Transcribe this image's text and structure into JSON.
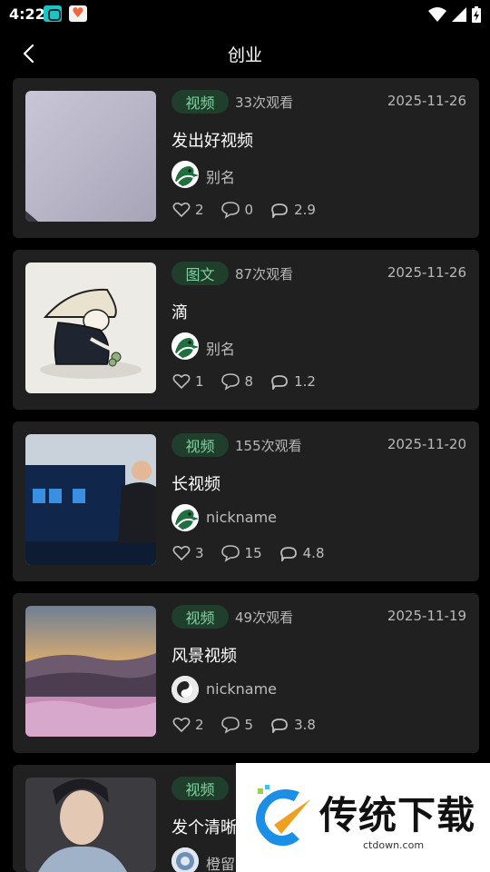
{
  "status_bar": {
    "time": "4:22"
  },
  "header": {
    "title": "创业"
  },
  "cards": [
    {
      "tag": "视频",
      "views": "33次观看",
      "date": "2025-11-26",
      "title": "发出好视频",
      "author": "别名",
      "likes": "2",
      "comments": "0",
      "score": "2.9"
    },
    {
      "tag": "图文",
      "views": "87次观看",
      "date": "2025-11-26",
      "title": "滴",
      "author": "别名",
      "likes": "1",
      "comments": "8",
      "score": "1.2"
    },
    {
      "tag": "视频",
      "views": "155次观看",
      "date": "2025-11-20",
      "title": "长视频",
      "author": "nickname",
      "likes": "3",
      "comments": "15",
      "score": "4.8"
    },
    {
      "tag": "视频",
      "views": "49次观看",
      "date": "2025-11-19",
      "title": "风景视频",
      "author": "nickname",
      "likes": "2",
      "comments": "5",
      "score": "3.8"
    },
    {
      "tag": "视频",
      "views": "",
      "date": "",
      "title": "发个清晰",
      "author": "橙留",
      "likes": "",
      "comments": "",
      "score": ""
    }
  ],
  "watermark": {
    "name": "传统下载",
    "url": "ctdown.com"
  },
  "colors": {
    "background": "#000000",
    "card": "#202021",
    "tag_bg": "#1f3e2c",
    "tag_text": "#7fd39e"
  }
}
